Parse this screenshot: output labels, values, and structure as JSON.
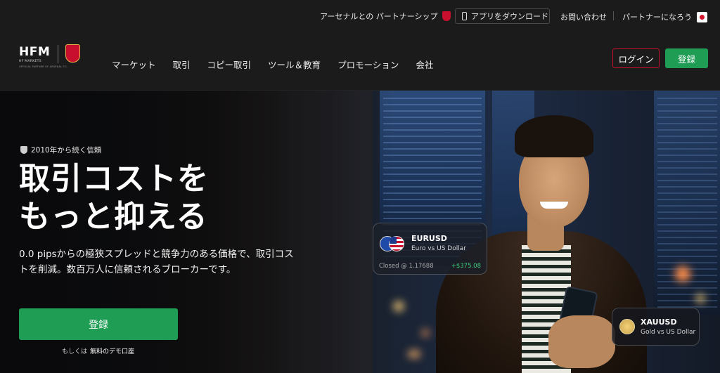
{
  "topbar": {
    "arsenal_partner": "アーセナルとの パートナーシップ",
    "app_download": "アプリをダウンロード",
    "contact": "お問い合わせ",
    "become_partner": "パートナーになろう"
  },
  "logo": {
    "brand": "HFM",
    "sub": "HF MARKETS",
    "partner_line": "OFFICIAL PARTNER OF ARSENAL F.C."
  },
  "nav": {
    "items": [
      {
        "label": "マーケット"
      },
      {
        "label": "取引"
      },
      {
        "label": "コピー取引"
      },
      {
        "label": "ツール＆教育"
      },
      {
        "label": "プロモーション"
      },
      {
        "label": "会社"
      }
    ],
    "login_label": "ログイン",
    "register_label": "登録"
  },
  "hero": {
    "badge": "2010年から続く信頼",
    "headline_line1": "取引コストを",
    "headline_line2": "もっと抑える",
    "subcopy": "0.0 pipsからの極狭スプレッドと競争力のある価格で、取引コストを削減。数百万人に信頼されるブローカーです。",
    "cta_label": "登録",
    "demo_prefix": "もしくは",
    "demo_link": "無料のデモ口座"
  },
  "cards": {
    "eurusd": {
      "symbol": "EURUSD",
      "name": "Euro vs US Dollar",
      "closed": "Closed @ 1.17688",
      "pnl": "+$375.08"
    },
    "xauusd": {
      "symbol": "XAUUSD",
      "name": "Gold vs US Dollar"
    }
  },
  "colors": {
    "accent_green": "#1f9d55",
    "accent_red": "#c8102e",
    "profit_green": "#3ccb7f"
  }
}
